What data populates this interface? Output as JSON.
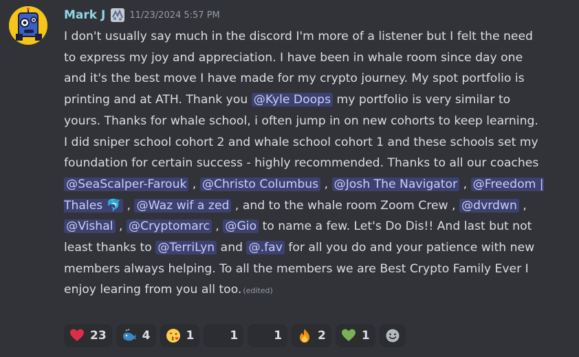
{
  "message": {
    "author": "Mark J",
    "timestamp": "11/23/2024 5:57 PM",
    "edited_label": "(edited)",
    "text": {
      "p1": "I don't usually say much in the discord I'm more of a listener but I felt the need to express my joy and appreciation. I have been in whale room since day one and it's the best move I have made for my crypto journey. My spot portfolio is printing and at ATH. Thank you ",
      "m_kyle": "@Kyle Doops",
      "p2": " my portfolio is very similar to yours. Thanks for whale school, i often jump in on new cohorts to keep learning. I did sniper school cohort 2 and whale school cohort 1 and these schools set my foundation for certain success - highly recommended. Thanks to all our coaches ",
      "m_seascalper": "@SeaScalper-Farouk",
      "sep1": " , ",
      "m_christo": "@Christo Columbus",
      "sep2": " , ",
      "m_josh": "@Josh The Navigator",
      "sep3": " , ",
      "m_freedom": "@Freedom | Thales 🐬",
      "sep4": " , ",
      "m_waz": "@Waz wif a zed",
      "p3": " , and to the whale room Zoom Crew , ",
      "m_dvrdwn": "@dvrdwn",
      "sep5": " , ",
      "m_vishal": "@Vishal",
      "sep6": " , ",
      "m_cryptomarc": "@Cryptomarc",
      "sep7": " , ",
      "m_gio": "@Gio",
      "p4": " to name a few. Let's Do Dis!! And last but not least thanks to ",
      "m_terrilyn": "@TerriLyn",
      "p5": " and ",
      "m_fav": "@.fav",
      "p6": " for all you do and your patience with new members always helping. To all the members we are Best Crypto Family Ever I enjoy learing from you all too."
    }
  },
  "reactions": [
    {
      "icon": "red-heart-icon",
      "count": "23"
    },
    {
      "icon": "whale-icon",
      "count": "4"
    },
    {
      "icon": "face-blowing-kiss-icon",
      "count": "1"
    },
    {
      "icon": "custom-emoji-dark-icon",
      "count": "1"
    },
    {
      "icon": "custom-emoji-dark-icon",
      "count": "1"
    },
    {
      "icon": "fire-icon",
      "count": "2"
    },
    {
      "icon": "green-heart-icon",
      "count": "1"
    }
  ],
  "colors": {
    "background": "#313338",
    "username": "#8fd7e8",
    "mention_bg": "#3c4270",
    "mention_text": "#c9cdfb",
    "reaction_bg": "#2b2d31"
  }
}
